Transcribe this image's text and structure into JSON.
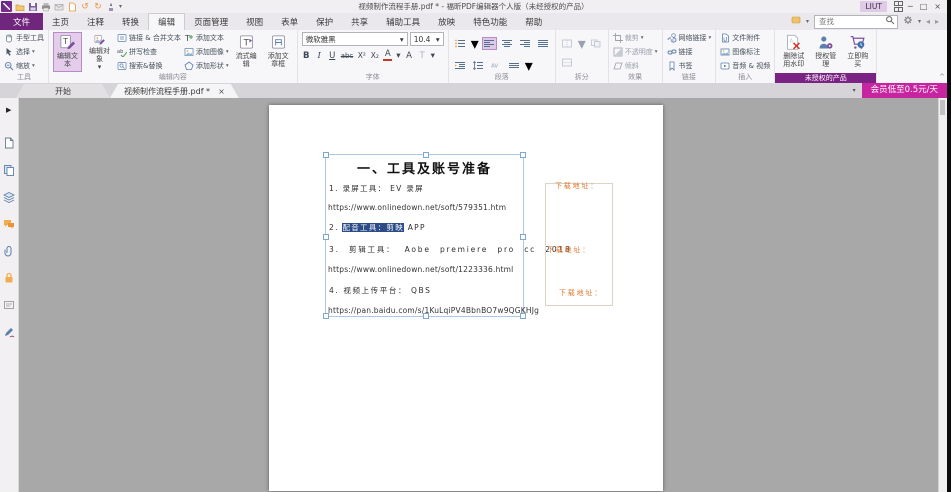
{
  "colors": {
    "accent_purple": "#70267d",
    "unauthorized_band": "#7b2384",
    "promo_magenta": "#c7259f",
    "text_selection": "#2b4c86",
    "download_orange": "#e0772f",
    "canvas_gray": "#a8a8a8"
  },
  "glyphs": {
    "caret": "▾",
    "close": "×",
    "minimize": "─",
    "restore": "□",
    "back": "◂",
    "forward": "▸",
    "undo": "↺",
    "redo": "↻",
    "expand": "▶",
    "collapse": "^"
  },
  "titlebar": {
    "title": "视频制作流程手册.pdf * - 福昕PDF编辑器个人版（未经授权的产品）",
    "user": "LIUT"
  },
  "tabrow": {
    "file": "文件",
    "tabs": [
      "主页",
      "注释",
      "转换",
      "编辑",
      "页面管理",
      "视图",
      "表单",
      "保护",
      "共享",
      "辅助工具",
      "放映",
      "特色功能",
      "帮助"
    ],
    "active": "编辑",
    "search_placeholder": "查找"
  },
  "ribbon": {
    "tools": {
      "label": "工具",
      "hand": "手型工具",
      "select": "选择",
      "zoom": "缩放"
    },
    "edit": {
      "label": "编辑内容",
      "edit_text": "编辑文本",
      "edit_object": "编辑对象",
      "link_merge": "链接 & 合并文本",
      "spell_check": "拼写检查",
      "search_replace": "搜索&替换",
      "add_text": "添加文本",
      "add_image": "添加图像",
      "add_shape": "添加形状",
      "flow_edit": "流式编辑",
      "add_article_box": "添加文章框"
    },
    "font": {
      "label": "字体",
      "family": "微软雅黑",
      "size": "10.4",
      "bold": "B",
      "italic": "I",
      "underline": "U",
      "strike": "abc",
      "superscript": "X²",
      "subscript": "X₂",
      "color": "A",
      "tracking": "A",
      "vscale": "T"
    },
    "paragraph": {
      "label": "段落"
    },
    "split": {
      "label": "拆分"
    },
    "effects": {
      "label": "效果",
      "crop": "裁剪",
      "opacity": "不透明度",
      "skew": "倾斜"
    },
    "links": {
      "label": "链接",
      "web_link": "网络链接",
      "link": "链接",
      "bookmark": "书签"
    },
    "insert": {
      "label": "插入",
      "attachment": "文件附件",
      "image_annotation": "图像标注",
      "audio_video": "音频 & 视频"
    },
    "unauthorized": {
      "label": "未授权的产品",
      "remove_watermark": "删除试用水印",
      "license_manage": "授权管理",
      "buy_now": "立即购买"
    }
  },
  "doctabs": {
    "start": "开始",
    "document": "视频制作流程手册.pdf *",
    "promo": "会员低至0.5元/天"
  },
  "page": {
    "title": "一、工具及账号准备",
    "line1": "1. 录屏工具： EV 录屏",
    "url1": "https://www.onlinedown.net/soft/579351.htm",
    "line2_prefix": "2. ",
    "line2_selected": "配音工具：剪映",
    "line2_suffix": " APP",
    "line3": "3. 剪辑工具： Aobe premiere pro cc 2018",
    "url2": "https://www.onlinedown.net/soft/1223336.html",
    "line4": "4. 视频上传平台： QBS",
    "url3": "https://pan.baidu.com/s/1KuLqiPV4BbnBO7w9QGKHJg",
    "download_label_1": "下载地址：",
    "download_label_2": "下载地址：",
    "download_label_3": "下载地址："
  }
}
